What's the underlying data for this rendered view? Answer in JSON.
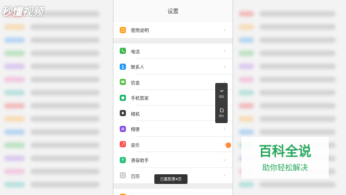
{
  "header": {
    "title": "设置"
  },
  "sections": [
    {
      "items": [
        {
          "label": "使用说明",
          "icon": "help-icon",
          "color": "#ff9c1a"
        }
      ]
    },
    {
      "items": [
        {
          "label": "电话",
          "icon": "phone-icon",
          "color": "#3bb54a"
        },
        {
          "label": "联系人",
          "icon": "contacts-icon",
          "color": "#2196f3"
        },
        {
          "label": "信息",
          "icon": "message-icon",
          "color": "#5cc24a"
        },
        {
          "label": "手机管家",
          "icon": "shield-icon",
          "color": "#1db36b"
        },
        {
          "label": "相机",
          "icon": "camera-icon",
          "color": "#444444"
        },
        {
          "label": "相册",
          "icon": "gallery-icon",
          "color": "#8a55e0"
        },
        {
          "label": "音乐",
          "icon": "music-icon",
          "color": "#ff4d4d"
        },
        {
          "label": "语音助手",
          "icon": "voice-icon",
          "color": "#2ec27e"
        },
        {
          "label": "日历",
          "icon": "calendar-icon",
          "color": "#cccccc"
        }
      ]
    },
    {
      "items": [
        {
          "label": "地图",
          "icon": "map-icon",
          "color": "#ff9c1a"
        }
      ]
    }
  ],
  "toast": "已截取第4页",
  "float_toolbar": {
    "collapse_label": "收起",
    "save_label": "保存"
  },
  "watermark": {
    "left": "秒懂视频",
    "brand": "百科全说",
    "slogan": "助你轻松解决"
  }
}
